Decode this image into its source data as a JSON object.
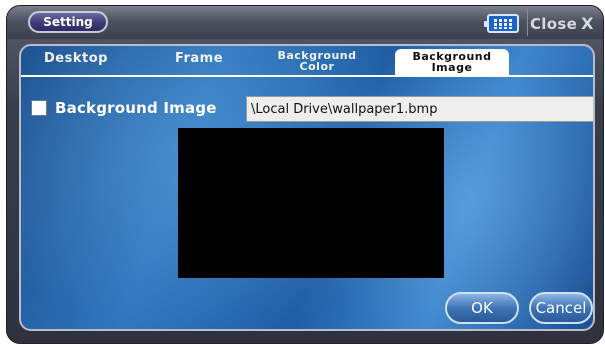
{
  "title_bar": {
    "title": "Setting",
    "close_label": "Close",
    "close_glyph": "X",
    "keyboard_icon": "keyboard-icon"
  },
  "tabs": [
    {
      "label": "Desktop",
      "active": false
    },
    {
      "label": "Frame",
      "active": false
    },
    {
      "label_line1": "Background",
      "label_line2": "Color",
      "active": false
    },
    {
      "label_line1": "Background",
      "label_line2": "Image",
      "active": true
    }
  ],
  "background_image": {
    "checkbox_checked": false,
    "label": "Background Image",
    "path_value": "\\Local Drive\\wallpaper1.bmp"
  },
  "buttons": {
    "ok": "OK",
    "cancel": "Cancel"
  },
  "colors": {
    "accent": "#2f76bd",
    "preview_fill": "#000000"
  }
}
